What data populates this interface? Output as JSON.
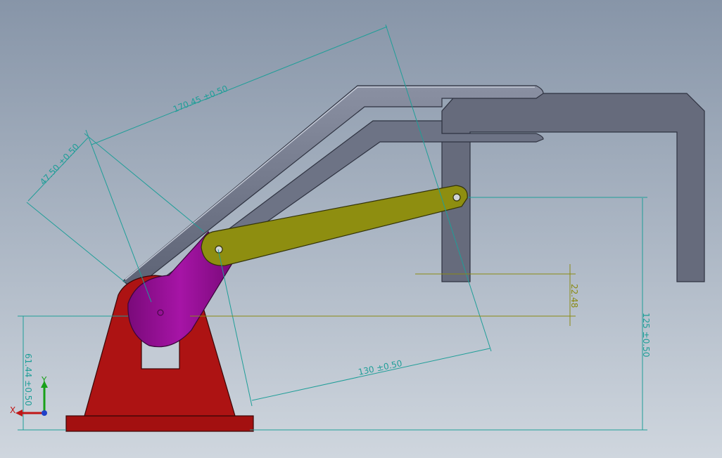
{
  "colors": {
    "base": "#b01212",
    "cylinder": "#9a0e9a",
    "link": "#8c8c0c",
    "arm": "#6a7082",
    "dimension": "#1f9e98",
    "ref_dimension": "#8a8a14"
  },
  "dimensions": {
    "d_170": "170.45 ±0.50",
    "d_47": "47.50 ±0.50",
    "d_130": "130 ±0.50",
    "d_125": "125 ±0.50",
    "d_61": "61.44 ±0.50",
    "d_22": "22.48"
  },
  "axes": {
    "x_label": "X",
    "y_label": "Y"
  }
}
